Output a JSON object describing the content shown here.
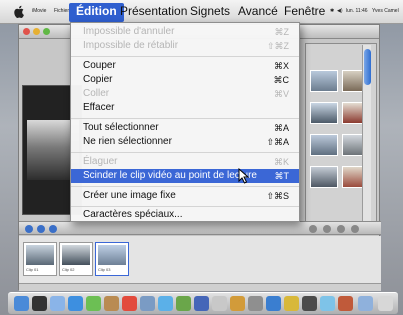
{
  "menubar": {
    "items": [
      "iMovie",
      "Fichier",
      "Édition",
      "Présentation",
      "Signets",
      "Avancé",
      "Fenêtre"
    ],
    "clock": "lun. 11:46",
    "user": "Yves Camel",
    "icons": [
      "apple-icon",
      "bluetooth-icon",
      "volume-icon"
    ]
  },
  "menu": {
    "items": [
      {
        "label": "Impossible d'annuler",
        "shortcut": "⌘Z",
        "enabled": false
      },
      {
        "label": "Impossible de rétablir",
        "shortcut": "⇧⌘Z",
        "enabled": false
      },
      {
        "label": "Couper",
        "shortcut": "⌘X",
        "enabled": true
      },
      {
        "label": "Copier",
        "shortcut": "⌘C",
        "enabled": true
      },
      {
        "label": "Coller",
        "shortcut": "⌘V",
        "enabled": false
      },
      {
        "label": "Effacer",
        "shortcut": "",
        "enabled": true
      },
      {
        "label": "Tout sélectionner",
        "shortcut": "⌘A",
        "enabled": true
      },
      {
        "label": "Ne rien sélectionner",
        "shortcut": "⇧⌘A",
        "enabled": true
      },
      {
        "label": "Élaguer",
        "shortcut": "⌘K",
        "enabled": false
      },
      {
        "label": "Scinder le clip vidéo au point de lecture",
        "shortcut": "⌘T",
        "enabled": true,
        "highlighted": true
      },
      {
        "label": "Créer une image fixe",
        "shortcut": "⇧⌘S",
        "enabled": true
      },
      {
        "label": "Caractères spéciaux...",
        "shortcut": "",
        "enabled": true
      }
    ]
  },
  "timeline": {
    "clips": [
      "Clip 01",
      "Clip 02",
      "Clip 03"
    ]
  },
  "colors": {
    "highlight": "#3b67d6",
    "menu_bg": "#f7f7f7",
    "disabled_text": "#b5b5b5"
  }
}
